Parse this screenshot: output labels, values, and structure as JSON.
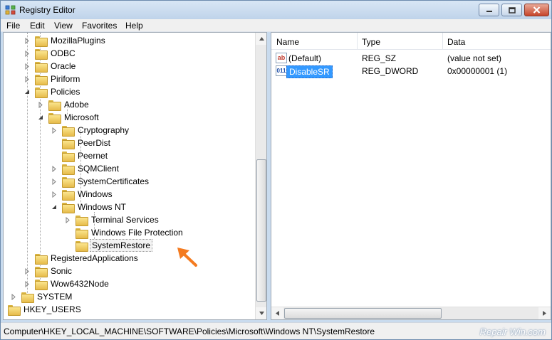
{
  "window": {
    "title": "Registry Editor",
    "app_icon": "regedit-icon"
  },
  "window_buttons": {
    "minimize_icon": "minimize-icon",
    "maximize_icon": "maximize-icon",
    "close_icon": "close-icon"
  },
  "menu": {
    "items": [
      "File",
      "Edit",
      "View",
      "Favorites",
      "Help"
    ]
  },
  "tree": {
    "nodes": [
      {
        "label": "MozillaPlugins",
        "expander": "collapsed"
      },
      {
        "label": "ODBC",
        "expander": "collapsed"
      },
      {
        "label": "Oracle",
        "expander": "collapsed"
      },
      {
        "label": "Piriform",
        "expander": "collapsed"
      },
      {
        "label": "Policies",
        "expander": "expanded"
      },
      {
        "label": "Adobe",
        "expander": "collapsed"
      },
      {
        "label": "Microsoft",
        "expander": "expanded"
      },
      {
        "label": "Cryptography",
        "expander": "collapsed"
      },
      {
        "label": "PeerDist",
        "expander": "none"
      },
      {
        "label": "Peernet",
        "expander": "none"
      },
      {
        "label": "SQMClient",
        "expander": "collapsed"
      },
      {
        "label": "SystemCertificates",
        "expander": "collapsed"
      },
      {
        "label": "Windows",
        "expander": "collapsed"
      },
      {
        "label": "Windows NT",
        "expander": "expanded"
      },
      {
        "label": "Terminal Services",
        "expander": "collapsed"
      },
      {
        "label": "Windows File Protection",
        "expander": "none"
      },
      {
        "label": "SystemRestore",
        "expander": "none",
        "selected": true
      },
      {
        "label": "RegisteredApplications",
        "expander": "none"
      },
      {
        "label": "Sonic",
        "expander": "collapsed"
      },
      {
        "label": "Wow6432Node",
        "expander": "collapsed"
      },
      {
        "label": "SYSTEM",
        "expander": "collapsed"
      },
      {
        "label": "HKEY_USERS",
        "expander": "collapsed"
      }
    ]
  },
  "list": {
    "columns": [
      "Name",
      "Type",
      "Data"
    ],
    "rows": [
      {
        "icon": "string-value-icon",
        "icon_glyph": "ab",
        "name": "(Default)",
        "type": "REG_SZ",
        "data": "(value not set)"
      },
      {
        "icon": "dword-value-icon",
        "icon_glyph": "011",
        "name": "DisableSR",
        "type": "REG_DWORD",
        "data": "0x00000001 (1)",
        "selected": true
      }
    ]
  },
  "status": {
    "path": "Computer\\HKEY_LOCAL_MACHINE\\SOFTWARE\\Policies\\Microsoft\\Windows NT\\SystemRestore"
  },
  "watermark": "Repair Win.com",
  "colors": {
    "selection": "#3399ff",
    "annotation_arrow": "#f47b20",
    "folder": "#e6bb4a"
  }
}
